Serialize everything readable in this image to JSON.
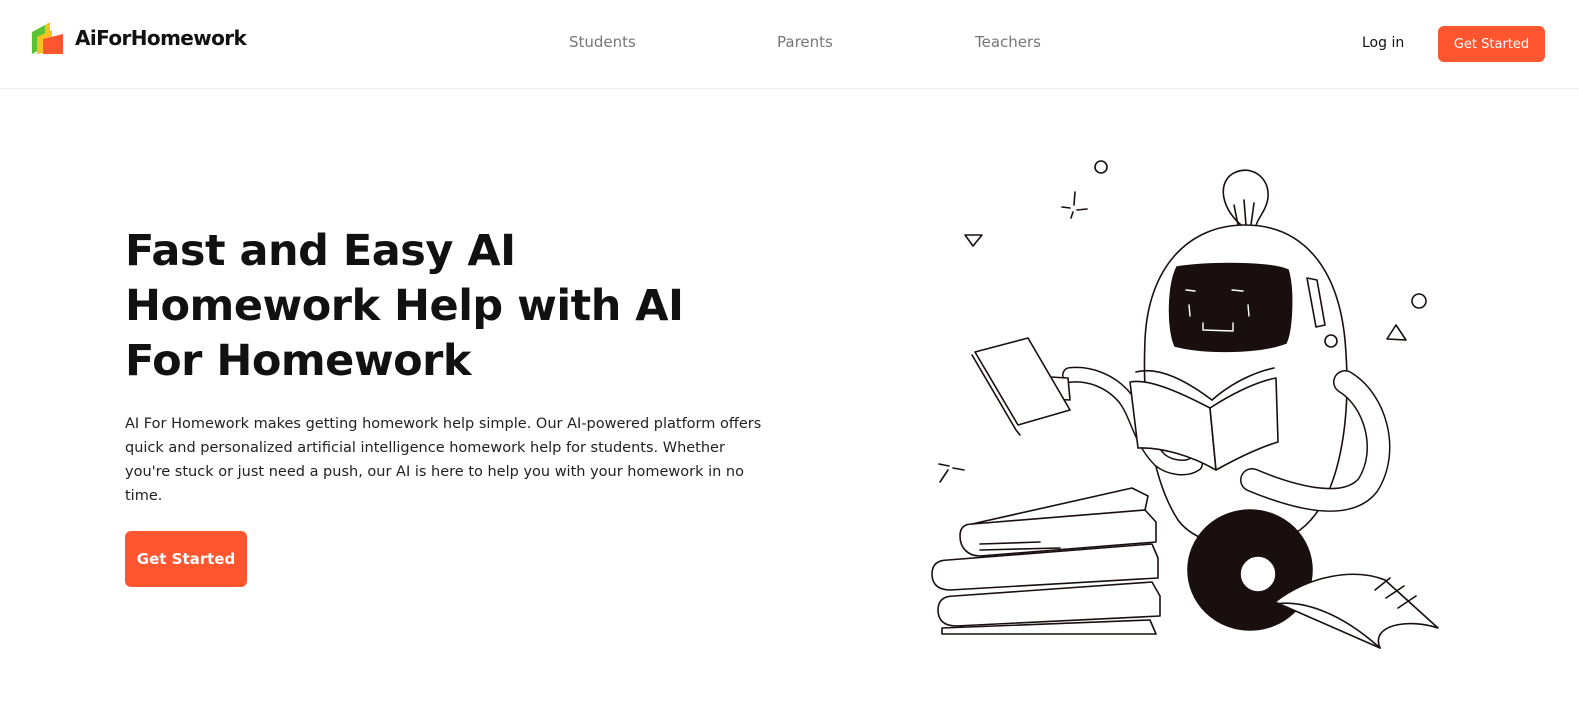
{
  "header": {
    "brand": "AiForHomework",
    "nav": [
      {
        "label": "Students"
      },
      {
        "label": "Parents"
      },
      {
        "label": "Teachers"
      }
    ],
    "login_label": "Log in",
    "cta_label": "Get Started"
  },
  "hero": {
    "title": "Fast and Easy AI Homework Help with AI For Homework",
    "description": "AI For Homework makes getting homework help simple. Our AI-powered platform offers quick and personalized artificial intelligence homework help for students. Whether you're stuck or just need a push, our AI is here to help you with your homework in no time.",
    "cta_label": "Get Started"
  },
  "colors": {
    "accent": "#ff5630",
    "logo_green": "#5bc236",
    "logo_yellow": "#f6c223",
    "logo_orange": "#ff5630",
    "nav_text": "#777777",
    "ink": "#111111"
  },
  "icons": {
    "logo": "book-stack-logo-icon",
    "illustration": "robot-reading-book-illustration"
  }
}
